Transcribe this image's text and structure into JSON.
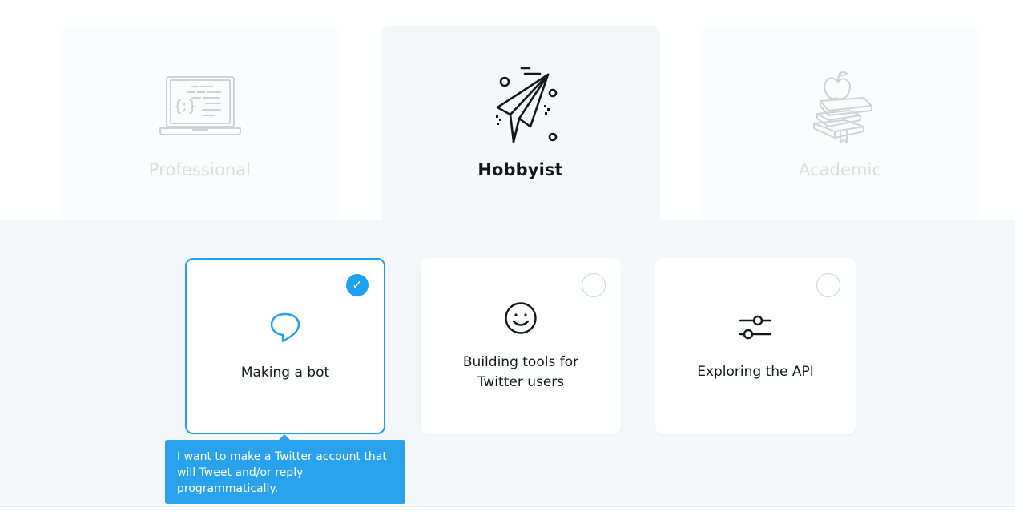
{
  "personas": [
    {
      "id": "professional",
      "label": "Professional",
      "icon": "laptop-code-icon",
      "selected": false
    },
    {
      "id": "hobbyist",
      "label": "Hobbyist",
      "icon": "paper-plane-icon",
      "selected": true
    },
    {
      "id": "academic",
      "label": "Academic",
      "icon": "books-apple-icon",
      "selected": false
    }
  ],
  "options": [
    {
      "id": "bot",
      "label": "Making a bot",
      "icon": "speech-bubble-icon",
      "selected": true,
      "check": "✓"
    },
    {
      "id": "tools",
      "label_line1": "Building tools for",
      "label_line2": "Twitter users",
      "icon": "smiley-face-icon",
      "selected": false
    },
    {
      "id": "api",
      "label": "Exploring the API",
      "icon": "sliders-icon",
      "selected": false
    }
  ],
  "tooltip": {
    "text": "I want to make a Twitter account that will Tweet and/or reply programmatically."
  },
  "colors": {
    "accent": "#1da1f2",
    "tooltip": "#2aa3ef",
    "panel": "#f5f8fa",
    "text": "#14171a",
    "muted": "#dcdfe2"
  }
}
